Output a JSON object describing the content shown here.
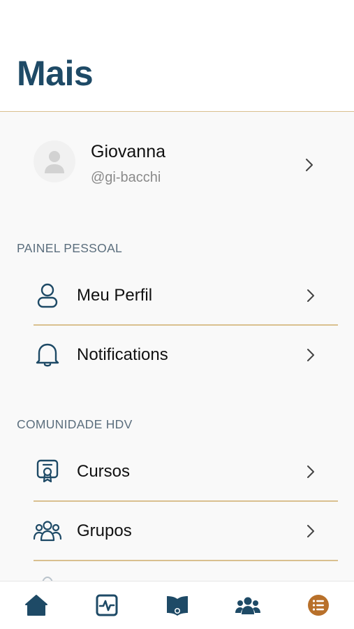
{
  "header": {
    "title": "Mais"
  },
  "profile": {
    "name": "Giovanna",
    "handle": "@gi-bacchi"
  },
  "sections": {
    "personal": {
      "title": "PAINEL PESSOAL",
      "items": [
        {
          "label": "Meu Perfil",
          "icon": "user-icon"
        },
        {
          "label": "Notifications",
          "icon": "bell-icon"
        }
      ]
    },
    "community": {
      "title": "COMUNIDADE HDV",
      "items": [
        {
          "label": "Cursos",
          "icon": "certificate-icon"
        },
        {
          "label": "Grupos",
          "icon": "users-group-icon"
        }
      ]
    }
  },
  "tabbar": {
    "tabs": [
      {
        "icon": "home-icon",
        "active": false
      },
      {
        "icon": "activity-icon",
        "active": false
      },
      {
        "icon": "book-icon",
        "active": false
      },
      {
        "icon": "community-icon",
        "active": false
      },
      {
        "icon": "list-icon",
        "active": true
      }
    ]
  },
  "colors": {
    "primary": "#1e4a66",
    "accent": "#b8702a",
    "divider": "#d9c08f",
    "section_text": "#5b6e7d"
  }
}
